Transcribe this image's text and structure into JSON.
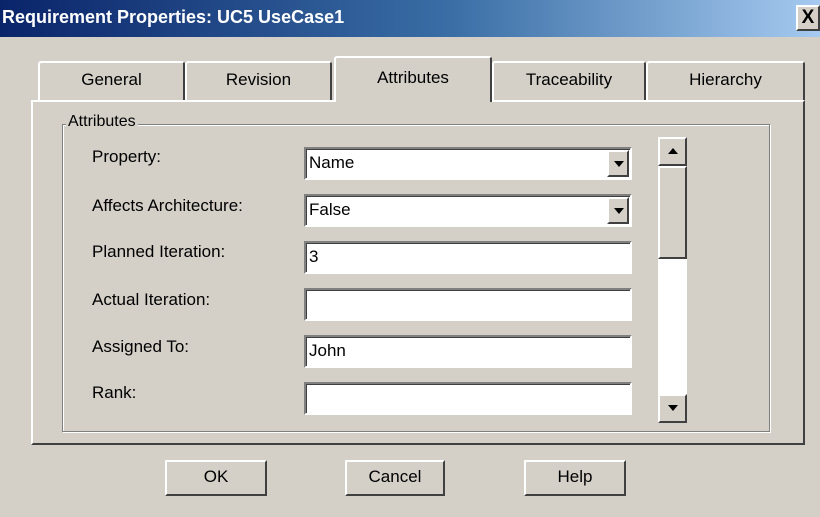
{
  "window": {
    "title": "Requirement Properties: UC5 UseCase1",
    "close_label": "X"
  },
  "tabs": [
    {
      "label": "General",
      "active": false
    },
    {
      "label": "Revision",
      "active": false
    },
    {
      "label": "Attributes",
      "active": true
    },
    {
      "label": "Traceability",
      "active": false
    },
    {
      "label": "Hierarchy",
      "active": false
    }
  ],
  "attributes": {
    "group_label": "Attributes",
    "rows": [
      {
        "label": "Property:",
        "value": "Name",
        "type": "dropdown"
      },
      {
        "label": "Affects Architecture:",
        "value": "False",
        "type": "dropdown"
      },
      {
        "label": "Planned Iteration:",
        "value": "3",
        "type": "text"
      },
      {
        "label": "Actual Iteration:",
        "value": "",
        "type": "text"
      },
      {
        "label": "Assigned To:",
        "value": "John",
        "type": "text"
      },
      {
        "label": "Rank:",
        "value": "",
        "type": "text"
      }
    ]
  },
  "buttons": {
    "ok": "OK",
    "cancel": "Cancel",
    "help": "Help"
  },
  "colors": {
    "dialog_bg": "#d4d0c8",
    "title_gradient_start": "#0a246a",
    "title_gradient_end": "#a6caf0"
  },
  "icons": {
    "dropdown": "chevron-down-icon",
    "scroll_up": "scroll-up-arrow-icon",
    "scroll_down": "scroll-down-arrow-icon"
  }
}
